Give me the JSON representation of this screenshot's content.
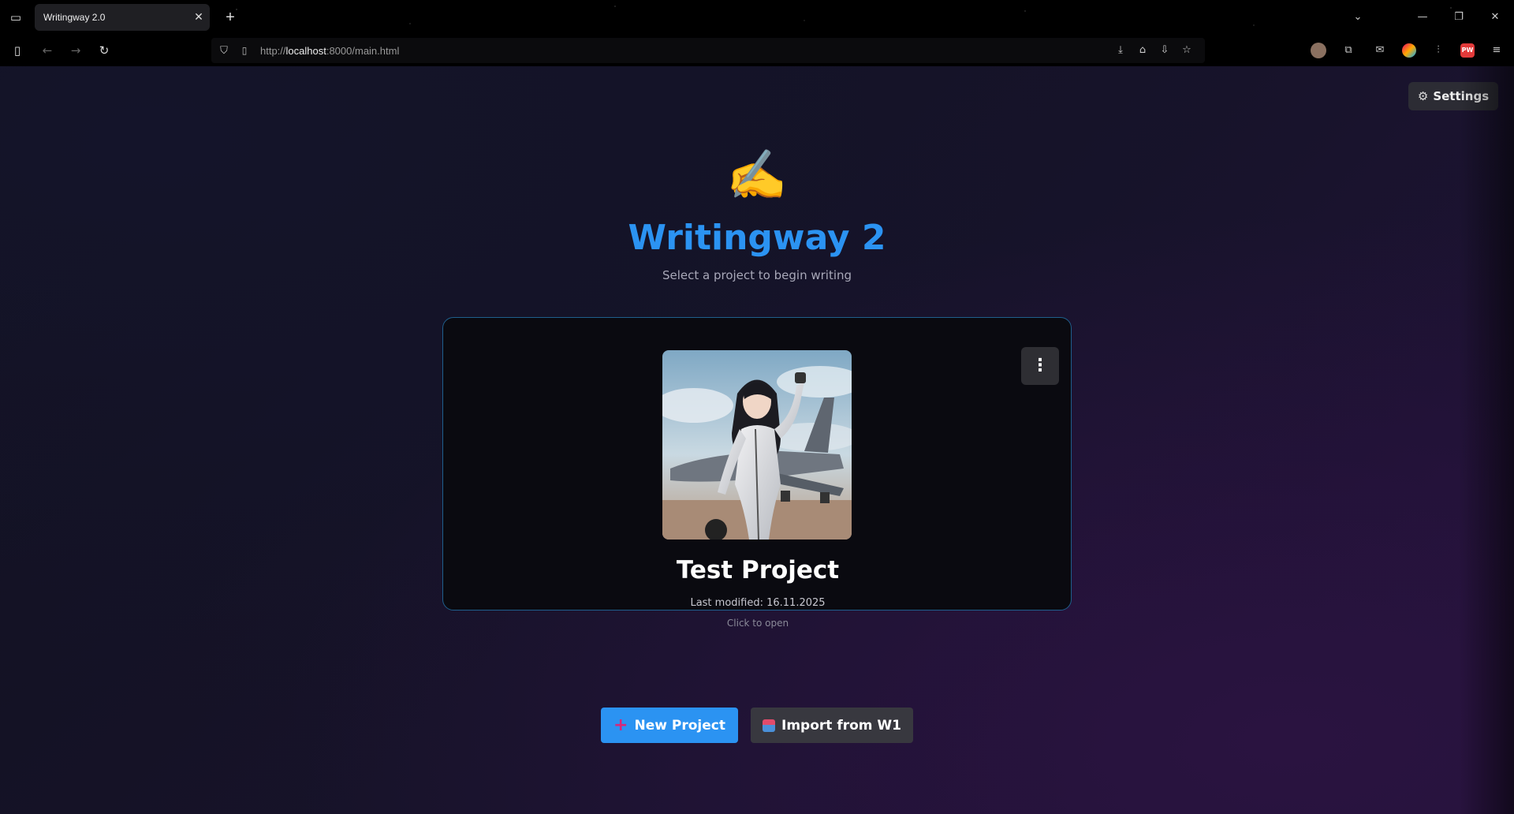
{
  "browser": {
    "tab_title": "Writingway 2.0",
    "tab_close": "✕",
    "new_tab": "+",
    "url_prefix": "http://",
    "url_host": "localhost",
    "url_rest": ":8000/main.html"
  },
  "header": {
    "settings_label": "Settings"
  },
  "hero": {
    "logo_emoji": "✍️",
    "title": "Writingway 2",
    "subtitle": "Select a project to begin writing"
  },
  "project": {
    "name": "Test Project",
    "last_modified": "Last modified: 16.11.2025",
    "hint": "Click to open",
    "menu_glyph": "⋮"
  },
  "actions": {
    "new_project_label": "New Project",
    "import_label": "Import from W1"
  },
  "colors": {
    "accent": "#2b93f2",
    "card_border": "#1f5f8c",
    "background": "#14132a"
  }
}
